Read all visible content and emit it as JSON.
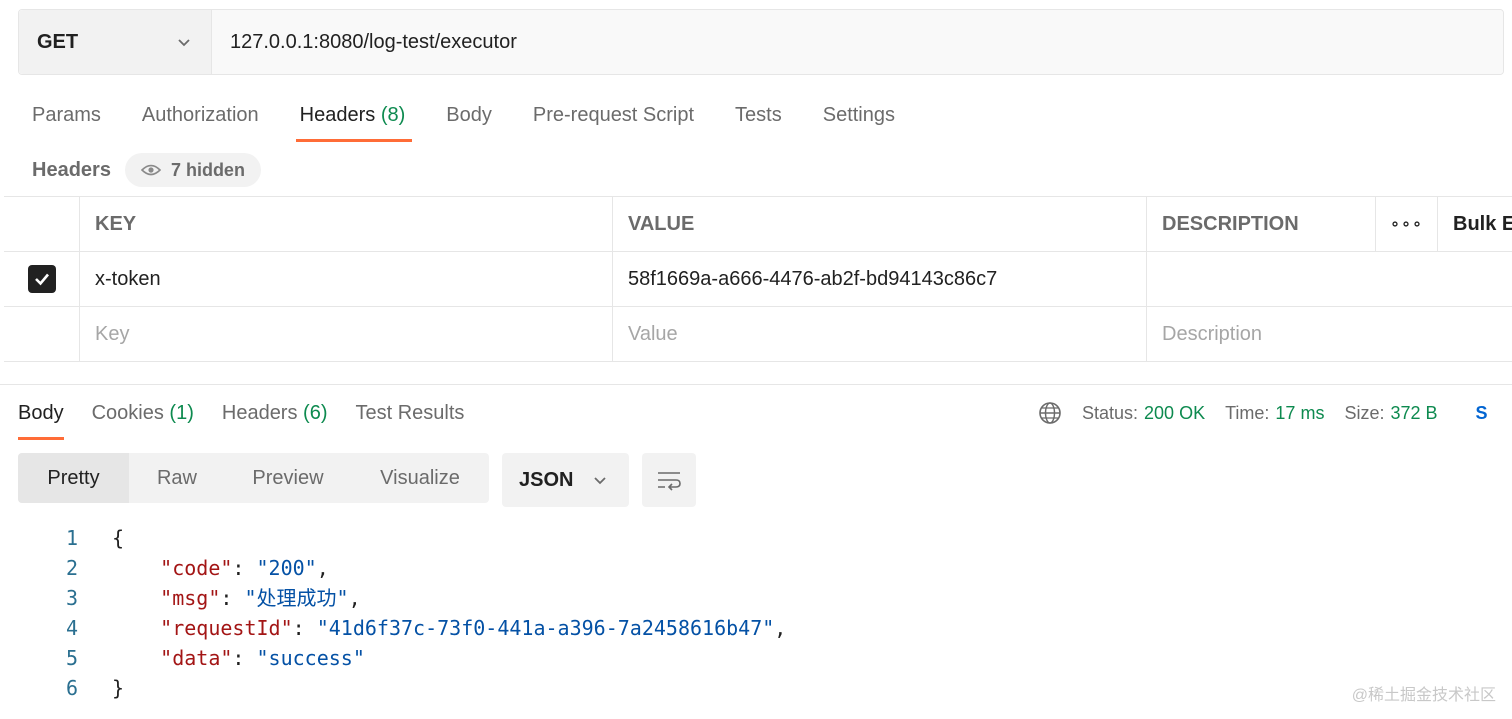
{
  "request": {
    "method": "GET",
    "url": "127.0.0.1:8080/log-test/executor"
  },
  "request_tabs": [
    {
      "label": "Params"
    },
    {
      "label": "Authorization"
    },
    {
      "label": "Headers",
      "count": "(8)"
    },
    {
      "label": "Body"
    },
    {
      "label": "Pre-request Script"
    },
    {
      "label": "Tests"
    },
    {
      "label": "Settings"
    }
  ],
  "headers_section": {
    "label": "Headers",
    "hidden": "7 hidden"
  },
  "headers_table": {
    "columns": [
      "KEY",
      "VALUE",
      "DESCRIPTION"
    ],
    "more": "∘∘∘",
    "bulk_edit": "Bulk E",
    "rows": [
      {
        "key": "x-token",
        "value": "58f1669a-a666-4476-ab2f-bd94143c86c7",
        "description": ""
      }
    ],
    "placeholders": {
      "key": "Key",
      "value": "Value",
      "description": "Description"
    }
  },
  "response_tabs": [
    {
      "label": "Body"
    },
    {
      "label": "Cookies",
      "count": "(1)"
    },
    {
      "label": "Headers",
      "count": "(6)"
    },
    {
      "label": "Test Results"
    }
  ],
  "response_status": {
    "status_label": "Status:",
    "status_value": "200 OK",
    "time_label": "Time:",
    "time_value": "17 ms",
    "size_label": "Size:",
    "size_value": "372 B",
    "save": "S"
  },
  "view_modes": [
    "Pretty",
    "Raw",
    "Preview",
    "Visualize"
  ],
  "format": "JSON",
  "code": {
    "line_numbers": [
      "1",
      "2",
      "3",
      "4",
      "5",
      "6"
    ],
    "open": "{",
    "close": "}",
    "fields": [
      {
        "key": "\"code\"",
        "value": "\"200\"",
        "sep": ","
      },
      {
        "key": "\"msg\"",
        "value": "\"处理成功\"",
        "sep": ","
      },
      {
        "key": "\"requestId\"",
        "value": "\"41d6f37c-73f0-441a-a396-7a2458616b47\"",
        "sep": ","
      },
      {
        "key": "\"data\"",
        "value": "\"success\"",
        "sep": ""
      }
    ]
  },
  "watermark": "@稀土掘金技术社区",
  "colors": {
    "accent": "#ff6c37",
    "success": "#0d8a4f",
    "link": "#0265d2"
  }
}
